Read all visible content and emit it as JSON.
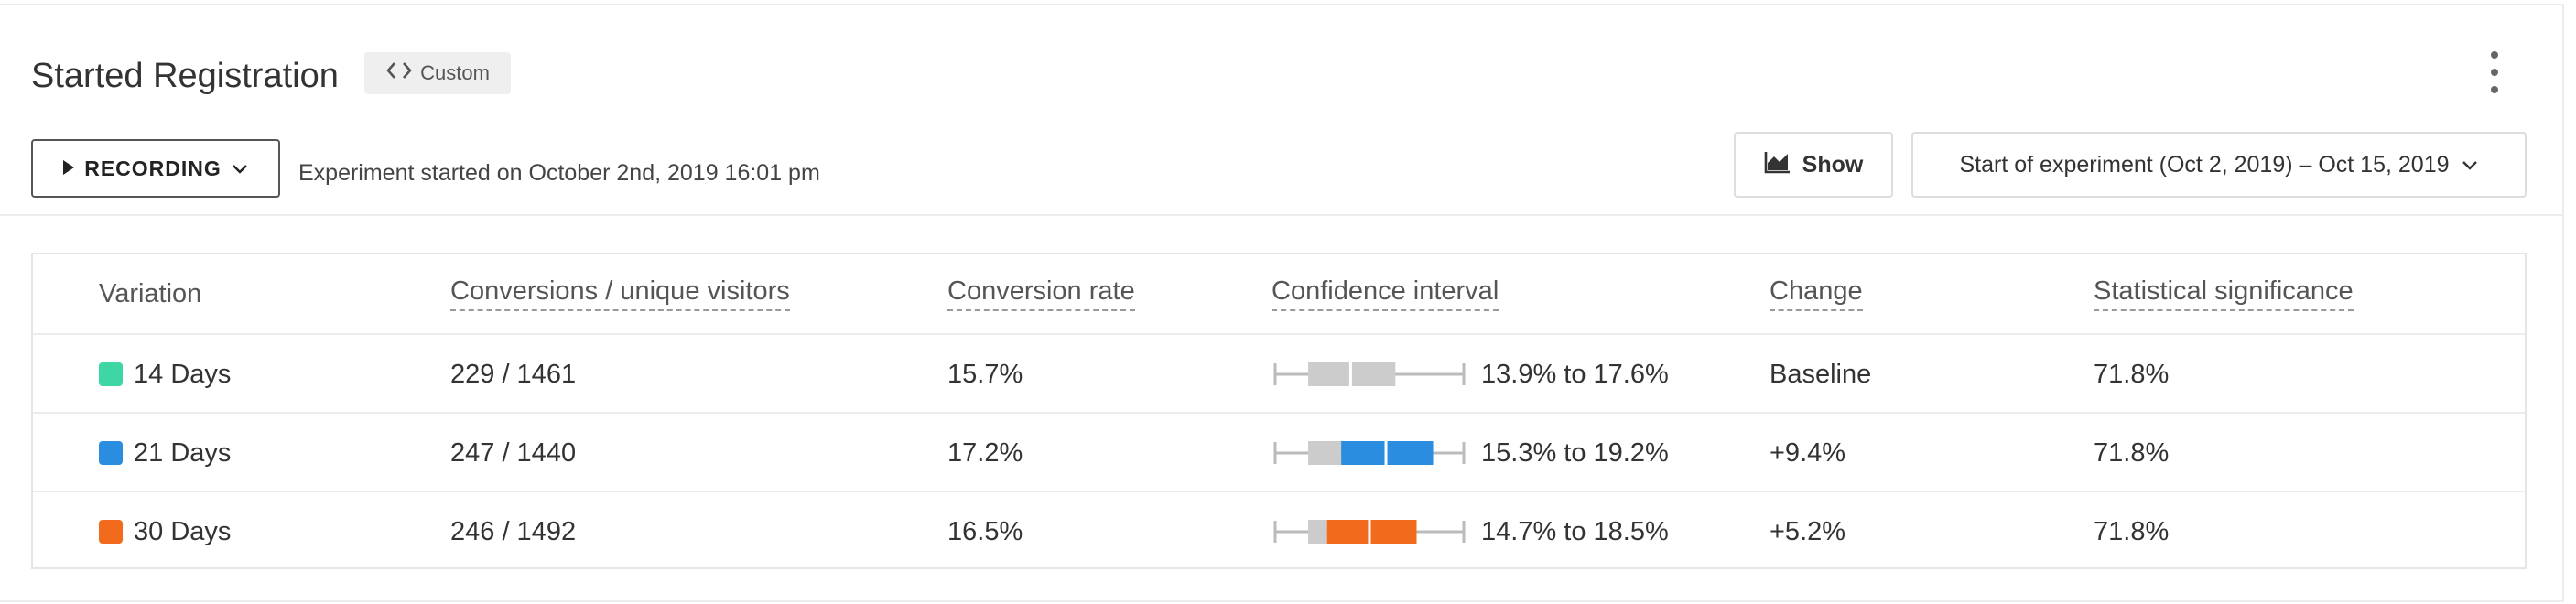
{
  "header": {
    "title": "Started Registration",
    "custom_label": "Custom"
  },
  "controls": {
    "recording_label": "RECORDING",
    "experiment_started": "Experiment started on October 2nd, 2019 16:01 pm",
    "show_label": "Show",
    "date_range": "Start of experiment (Oct 2, 2019) – Oct 15, 2019"
  },
  "table": {
    "columns": [
      "Variation",
      "Conversions / unique visitors",
      "Conversion rate",
      "Confidence interval",
      "Change",
      "Statistical significance"
    ],
    "rows": [
      {
        "variation": "14 Days",
        "color": "#3fd6a5",
        "conversions": "229 / 1461",
        "rate": "15.7%",
        "ci_low": 13.9,
        "ci_high": 17.6,
        "ci_text": "13.9% to 17.6%",
        "change": "Baseline",
        "significance": "71.8%"
      },
      {
        "variation": "21 Days",
        "color": "#2b8de0",
        "conversions": "247 / 1440",
        "rate": "17.2%",
        "ci_low": 15.3,
        "ci_high": 19.2,
        "ci_text": "15.3% to 19.2%",
        "change": "+9.4%",
        "significance": "71.8%"
      },
      {
        "variation": "30 Days",
        "color": "#f26b1d",
        "conversions": "246 / 1492",
        "rate": "16.5%",
        "ci_low": 14.7,
        "ci_high": 18.5,
        "ci_text": "14.7% to 18.5%",
        "change": "+5.2%",
        "significance": "71.8%"
      }
    ]
  },
  "colors": {
    "baseline_interval": "#cccccc",
    "range_line": "#bbbbbb"
  }
}
